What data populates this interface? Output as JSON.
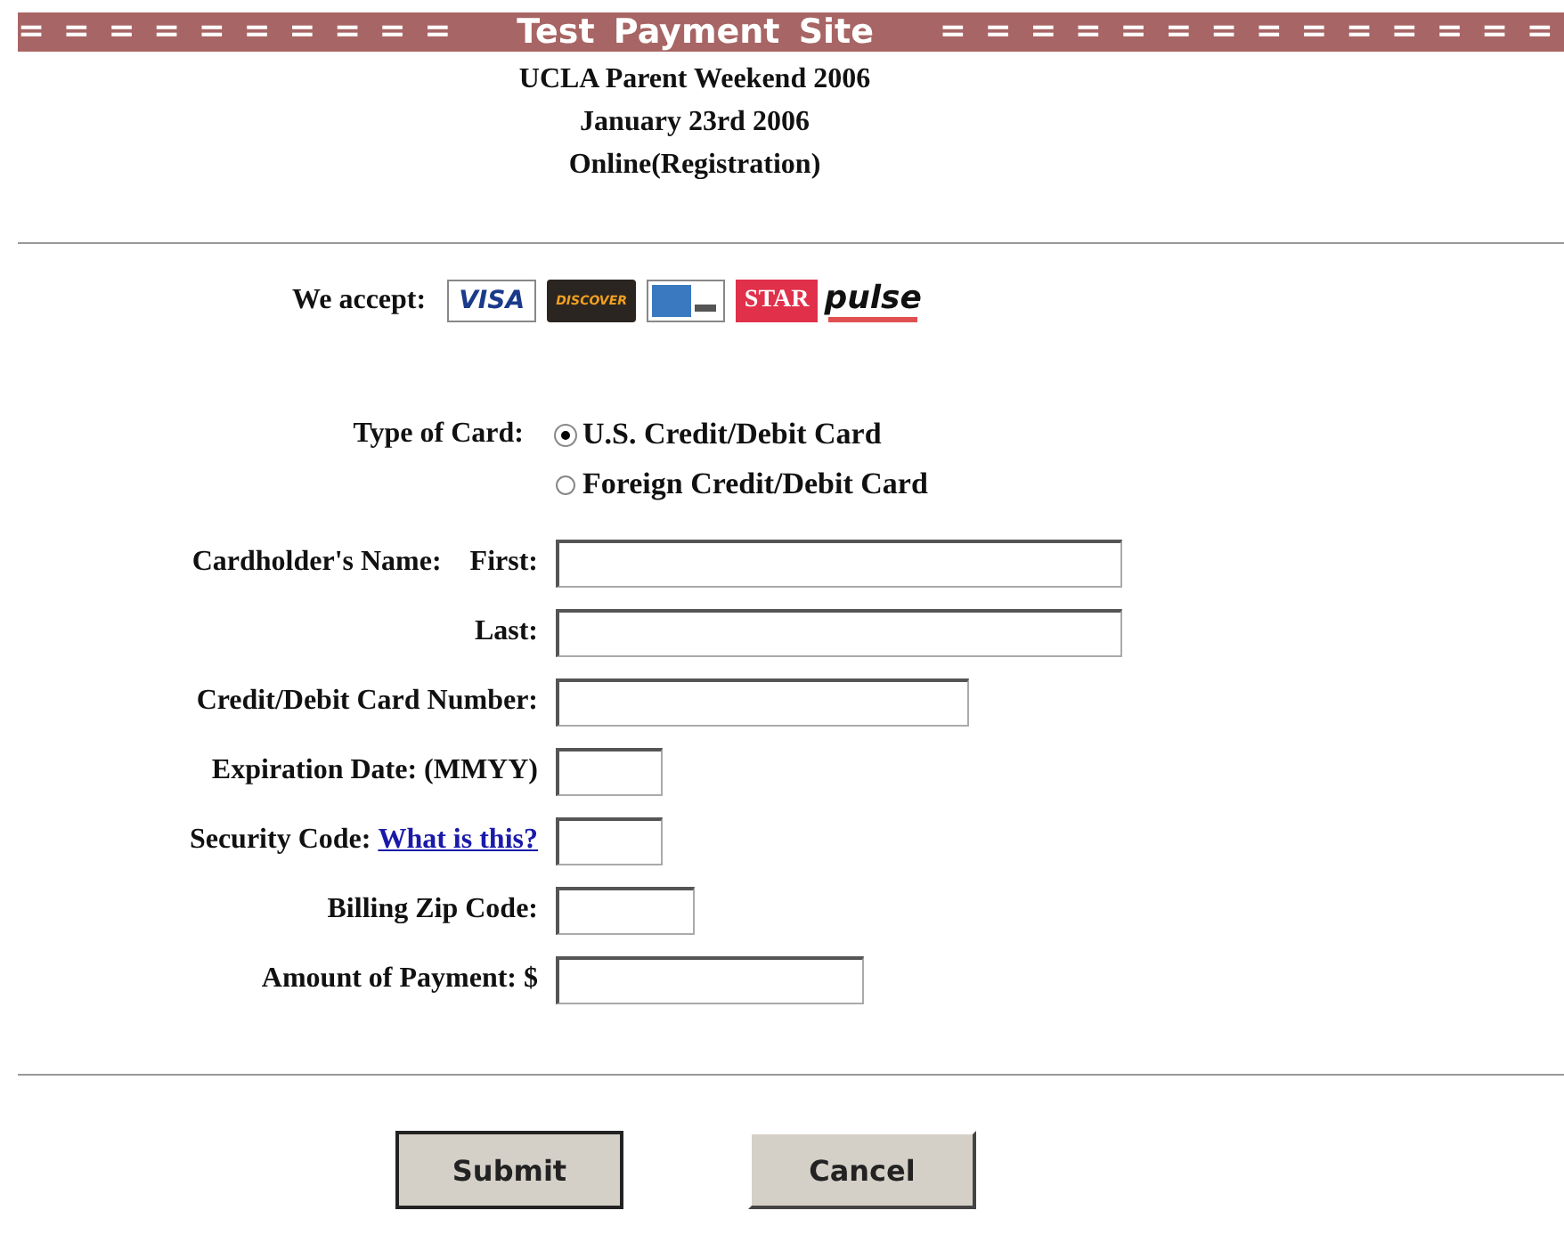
{
  "banner": {
    "left": "= = = = = = = = = =",
    "title": "Test Payment Site",
    "right": "= = = = = = = = = = = = = ="
  },
  "heading": [
    "UCLA Parent Weekend 2006",
    "January 23rd 2006",
    "Online(Registration)"
  ],
  "accept": {
    "label": "We accept:",
    "cards": [
      {
        "kind": "visa",
        "text": "VISA"
      },
      {
        "kind": "discover",
        "text": "DISCOVER"
      },
      {
        "kind": "amex"
      },
      {
        "kind": "star",
        "text": "STAR"
      },
      {
        "kind": "pulse",
        "text": "pulse"
      }
    ]
  },
  "card_type": {
    "label": "Type of Card:",
    "options": [
      {
        "label": "U.S. Credit/Debit Card",
        "selected": true
      },
      {
        "label": "Foreign Credit/Debit Card",
        "selected": false
      }
    ]
  },
  "fields": [
    {
      "group": "Cardholder's Name:",
      "label": "First:"
    },
    {
      "label": "Last:"
    },
    {
      "label": "Credit/Debit Card Number:"
    },
    {
      "label": "Expiration Date: (MMYY)"
    },
    {
      "label": "Security Code:",
      "link": "What is this?"
    },
    {
      "label": "Billing Zip Code:"
    },
    {
      "label": "Amount of Payment: $"
    }
  ],
  "buttons": [
    "Submit",
    "Cancel"
  ]
}
